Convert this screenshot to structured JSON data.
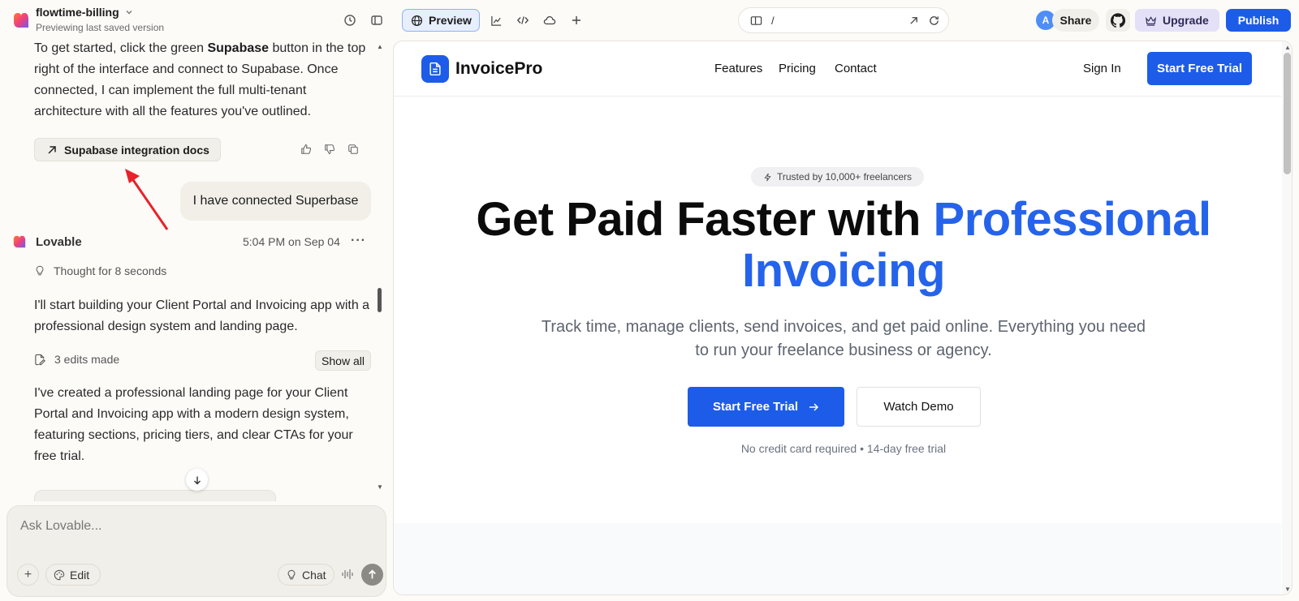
{
  "topbar": {
    "project_name": "flowtime-billing",
    "project_subtitle": "Previewing last saved version",
    "preview_label": "Preview",
    "url_path": "/",
    "avatar_initial": "A",
    "share_label": "Share",
    "upgrade_label": "Upgrade",
    "publish_label": "Publish",
    "icons": [
      "history-icon",
      "sidebar-toggle-icon",
      "globe-icon",
      "analytics-icon",
      "code-icon",
      "cloud-icon",
      "plus-icon",
      "device-icon",
      "open-external-icon",
      "refresh-icon",
      "github-icon",
      "crown-icon"
    ]
  },
  "chat": {
    "intro_text_before": "To get started, click the green ",
    "intro_bold": "Supabase",
    "intro_text_after": " button in the top right of the interface and connect to Supabase. Once connected, I can implement the full multi-tenant architecture with all the features you've outlined.",
    "docs_button_label": "Supabase integration docs",
    "user_message": "I have connected Superbase",
    "assistant_name": "Lovable",
    "assistant_time": "5:04 PM on Sep 04",
    "more_label": "···",
    "thought_label": "Thought for 8 seconds",
    "message_1": "I'll start building your Client Portal and Invoicing app with a professional design system and landing page.",
    "edits_label": "3 edits made",
    "show_all_label": "Show all",
    "message_2": "I've created a professional landing page for your Client Portal and Invoicing app with a modern design system, featuring sections, pricing tiers, and clear CTAs for your free trial.",
    "composer_placeholder": "Ask Lovable...",
    "composer_plus": "+",
    "edit_label": "Edit",
    "chat_label": "Chat"
  },
  "site": {
    "brand": "InvoicePro",
    "nav_links": [
      "Features",
      "Pricing",
      "Contact"
    ],
    "sign_in": "Sign In",
    "nav_cta": "Start Free Trial",
    "trust_badge": "Trusted by 10,000+ freelancers",
    "hero_title_plain": "Get Paid Faster with ",
    "hero_title_accent": "Professional Invoicing",
    "hero_subtitle": "Track time, manage clients, send invoices, and get paid online. Everything you need to run your freelance business or agency.",
    "primary_cta": "Start Free Trial",
    "secondary_cta": "Watch Demo",
    "note": "No credit card required • 14-day free trial"
  },
  "colors": {
    "accent_blue": "#1d5ce8",
    "hero_accent": "#2563eb",
    "annotation_red": "#e8222a",
    "panel_bg": "#fcfbf8"
  }
}
